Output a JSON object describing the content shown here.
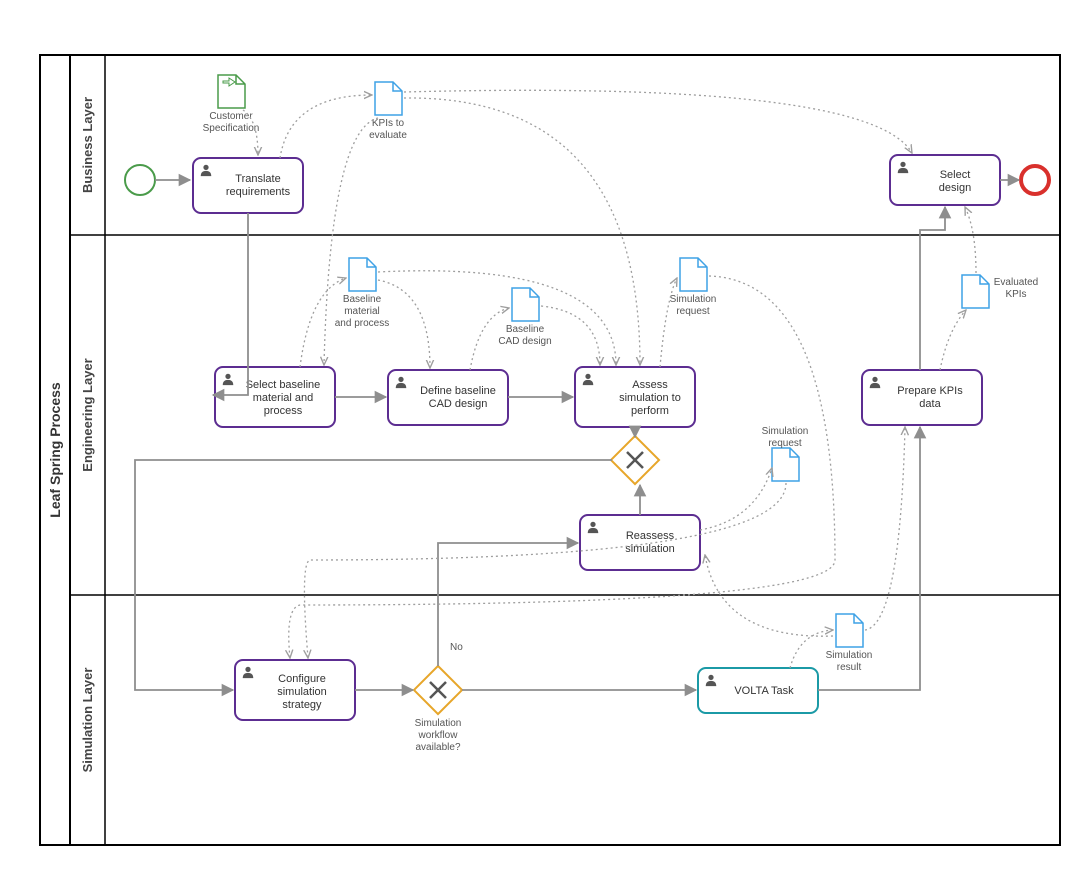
{
  "pool": {
    "title": "Leaf Spring Process"
  },
  "lanes": {
    "business": "Business Layer",
    "engineering": "Engineering Layer",
    "simulation": "Simulation Layer"
  },
  "tasks": {
    "translate": "Translate requirements",
    "selectBaseline": "Select baseline material and process",
    "defineCad": "Define baseline CAD design",
    "assess": "Assess simulation to perform",
    "reassess": "Reassess simulation",
    "prepareKpi": "Prepare KPIs data",
    "selectDesign": "Select design",
    "configureSim": "Configure simulation strategy",
    "volta": "VOLTA Task"
  },
  "documents": {
    "customerSpec": "Customer Specification",
    "kpisEval": "KPIs to evaluate",
    "baselineMat": "Baseline material and process",
    "baselineCad": "Baseline CAD design",
    "simReq1": "Simulation request",
    "simReq2": "Simulation request",
    "simResult": "Simulation result",
    "evalKpis": "Evaluated KPIs"
  },
  "gateways": {
    "simAvailable": "Simulation workflow available?",
    "noLabel": "No"
  }
}
